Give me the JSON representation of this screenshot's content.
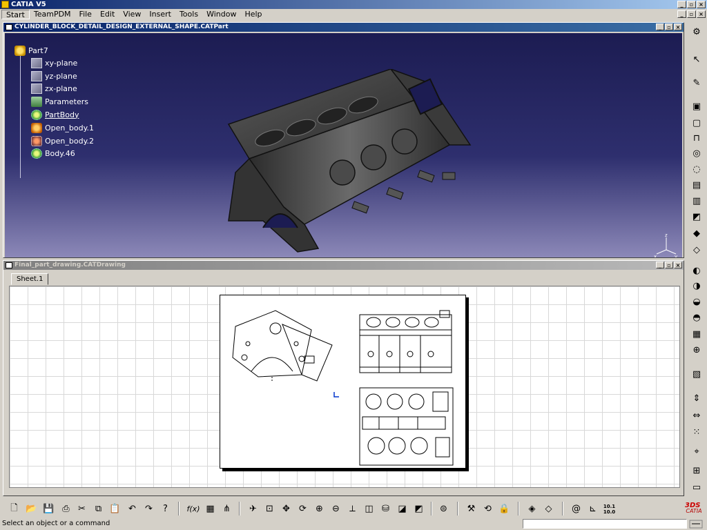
{
  "app": {
    "title": "CATIA V5"
  },
  "menu": {
    "items": [
      "Start",
      "TeamPDM",
      "File",
      "Edit",
      "View",
      "Insert",
      "Tools",
      "Window",
      "Help"
    ],
    "active": "Start"
  },
  "part_window": {
    "title": "CYLINDER_BLOCK_DETAIL_DESIGN_EXTERNAL_SHAPE.CATPart",
    "tree": {
      "root": "Part7",
      "items": [
        "xy-plane",
        "yz-plane",
        "zx-plane",
        "Parameters",
        "PartBody",
        "Open_body.1",
        "Open_body.2",
        "Body.46"
      ]
    },
    "axis_labels": {
      "z": "z",
      "y": "y",
      "x": "x"
    }
  },
  "drawing_window": {
    "title": "Final_part_drawing.CATDrawing",
    "sheet_tab": "Sheet.1"
  },
  "toolbar": {
    "formula_label": "f(x)",
    "scale_label": "10.1\n10.0"
  },
  "status": {
    "prompt": "Select an object or a command",
    "input_value": ""
  },
  "colors": {
    "title_active": "#0a246a",
    "viewport_top": "#1c1c52",
    "viewport_bottom": "#8c88b8",
    "chrome": "#d4d0c8"
  }
}
